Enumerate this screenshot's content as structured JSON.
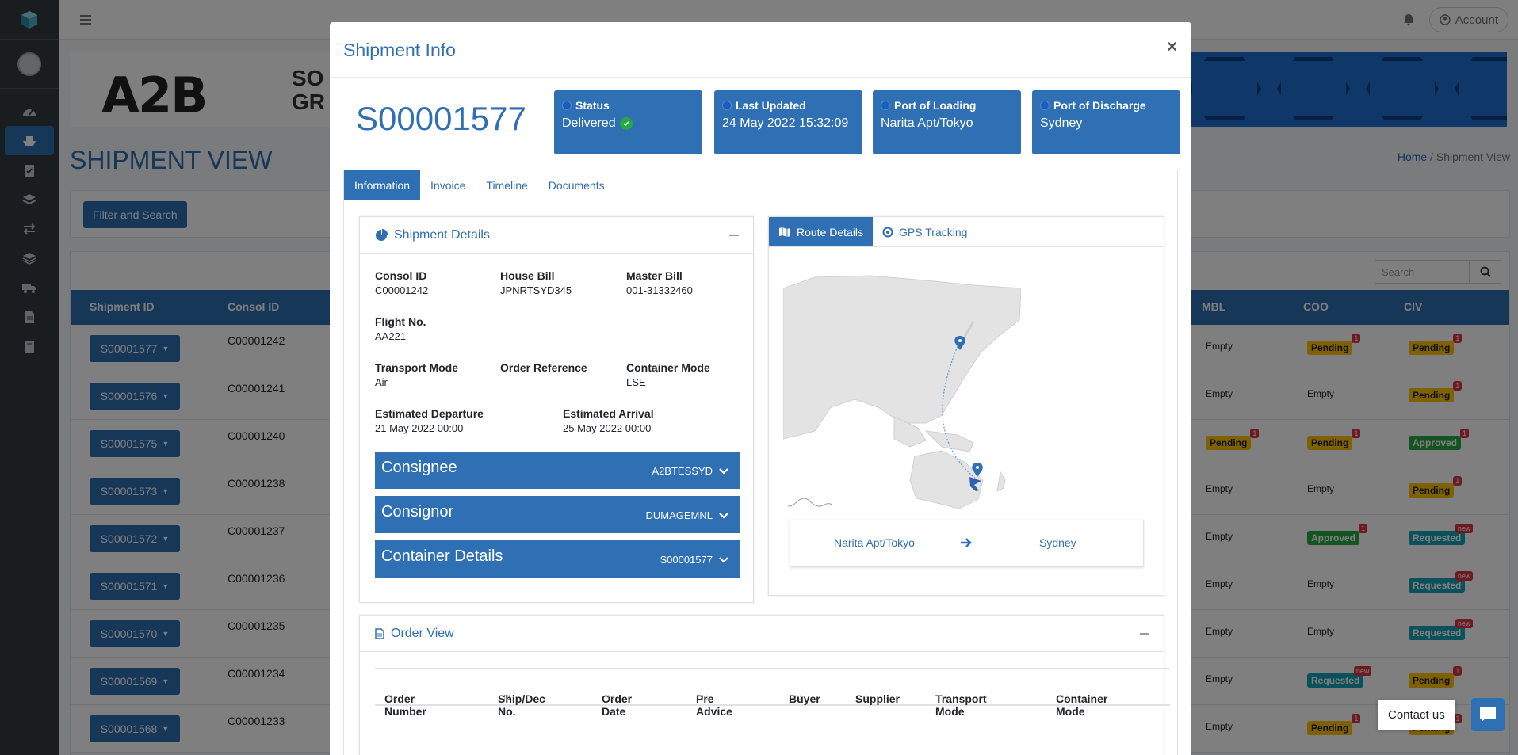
{
  "topbar": {
    "account_label": "Account"
  },
  "banner": {
    "brand": "A2B",
    "brand_sub_1": "SO",
    "brand_sub_2": "GR"
  },
  "page": {
    "title": "SHIPMENT VIEW",
    "breadcrumb_home": "Home",
    "breadcrumb_sep": "/",
    "breadcrumb_current": "Shipment View"
  },
  "filter": {
    "button_label": "Filter and Search"
  },
  "table": {
    "search_placeholder": "Search",
    "headers": {
      "shipment_id": "Shipment ID",
      "consol_id": "Consol ID",
      "mbl": "MBL",
      "coo": "COO",
      "civ": "CIV"
    },
    "rows": [
      {
        "shipment_id": "S00001577",
        "consol_id": "C00001242",
        "mbl": "Empty",
        "coo": "Pending",
        "coo_badge": "1",
        "civ": "Pending",
        "civ_badge": "1"
      },
      {
        "shipment_id": "S00001576",
        "consol_id": "C00001241",
        "mbl": "Empty",
        "coo": "Empty",
        "coo_badge": "",
        "civ": "Pending",
        "civ_badge": "1"
      },
      {
        "shipment_id": "S00001575",
        "consol_id": "C00001240",
        "mbl": "Pending",
        "mbl_badge": "1",
        "coo": "Pending",
        "coo_badge": "1",
        "civ": "Approved",
        "civ_badge": "1"
      },
      {
        "shipment_id": "S00001573",
        "consol_id": "C00001238",
        "mbl": "Empty",
        "coo": "Empty",
        "coo_badge": "",
        "civ": "Pending",
        "civ_badge": "1"
      },
      {
        "shipment_id": "S00001572",
        "consol_id": "C00001237",
        "mbl": "Empty",
        "coo": "Approved",
        "coo_badge": "1",
        "civ": "Requested",
        "civ_badge": "new"
      },
      {
        "shipment_id": "S00001571",
        "consol_id": "C00001236",
        "mbl": "Empty",
        "coo": "Empty",
        "coo_badge": "",
        "civ": "Requested",
        "civ_badge": "new"
      },
      {
        "shipment_id": "S00001570",
        "consol_id": "C00001235",
        "mbl": "Empty",
        "coo": "Empty",
        "coo_badge": "",
        "civ": "Requested",
        "civ_badge": "new"
      },
      {
        "shipment_id": "S00001569",
        "consol_id": "C00001234",
        "mbl": "Empty",
        "coo": "Requested",
        "coo_badge": "new",
        "civ": "Pending",
        "civ_badge": "1"
      },
      {
        "shipment_id": "S00001568",
        "consol_id": "C00001233",
        "mbl": "Empty",
        "coo": "Pending",
        "coo_badge": "1",
        "civ": "Pending",
        "civ_badge": "1"
      }
    ]
  },
  "modal": {
    "title": "Shipment Info",
    "close": "×",
    "shipment_id": "S00001577",
    "status_label": "Status",
    "status_value": "Delivered",
    "last_updated_label": "Last Updated",
    "last_updated_value": "24 May 2022 15:32:09",
    "pol_label": "Port of Loading",
    "pol_value": "Narita Apt/Tokyo",
    "pod_label": "Port of Discharge",
    "pod_value": "Sydney",
    "tabs": [
      "Information",
      "Invoice",
      "Timeline",
      "Documents"
    ],
    "details": {
      "title": "Shipment Details",
      "consol_id_label": "Consol ID",
      "consol_id": "C00001242",
      "house_bill_label": "House Bill",
      "house_bill": "JPNRTSYD345",
      "master_bill_label": "Master Bill",
      "master_bill": "001-31332460",
      "flight_label": "Flight No.",
      "flight": "AA221",
      "transport_mode_label": "Transport Mode",
      "transport_mode": "Air",
      "order_ref_label": "Order Reference",
      "order_ref": "-",
      "container_mode_label": "Container Mode",
      "container_mode": "LSE",
      "etd_label": "Estimated Departure",
      "etd": "21 May 2022 00:00",
      "eta_label": "Estimated Arrival",
      "eta": "25 May 2022 00:00"
    },
    "accordions": [
      {
        "title": "Consignee",
        "value": "A2BTESSYD"
      },
      {
        "title": "Consignor",
        "value": "DUMAGEMNL"
      },
      {
        "title": "Container Details",
        "value": "S00001577"
      }
    ],
    "route": {
      "tab_route": "Route Details",
      "tab_gps": "GPS Tracking",
      "from": "Narita Apt/Tokyo",
      "to": "Sydney"
    },
    "orders": {
      "title": "Order View",
      "headers": [
        "Order Number",
        "Ship/Dec No.",
        "Order Date",
        "Pre Advice",
        "Buyer",
        "Supplier",
        "Transport Mode",
        "Container Mode"
      ]
    }
  },
  "contact": {
    "label": "Contact us"
  },
  "colors": {
    "primary": "#2f6fb3",
    "sidebar": "#343a40",
    "pending": "#ffc107",
    "approved": "#28a745",
    "requested": "#17a2b8",
    "badge_red": "#dc3545"
  }
}
